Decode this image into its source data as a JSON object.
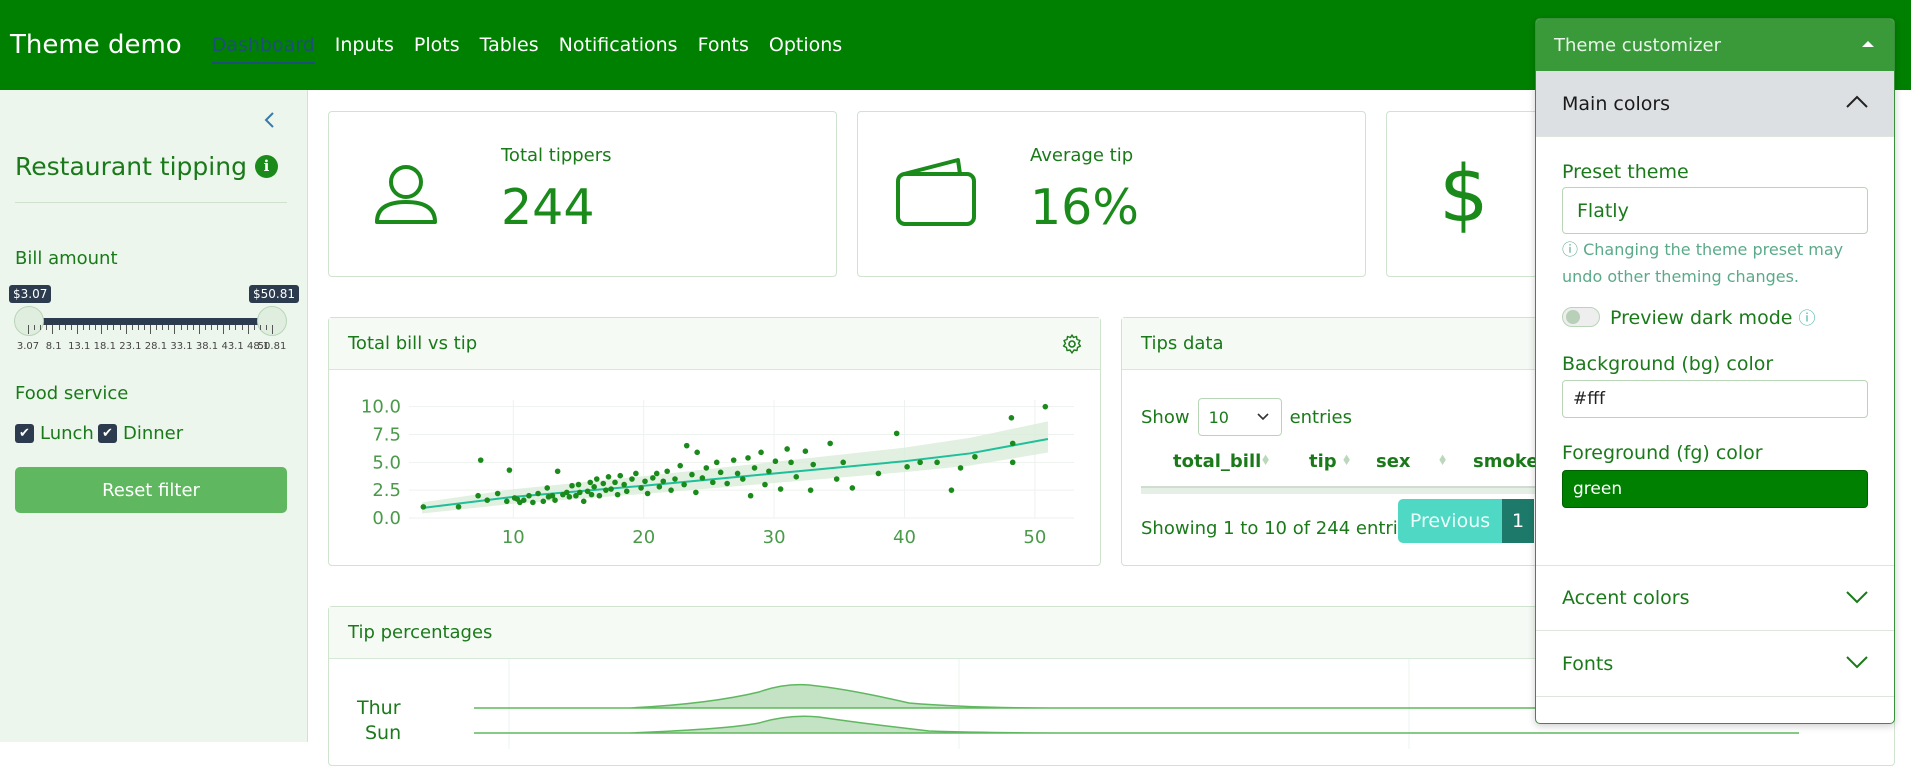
{
  "navbar": {
    "brand": "Theme demo",
    "links": [
      "Dashboard",
      "Inputs",
      "Plots",
      "Tables",
      "Notifications",
      "Fonts",
      "Options"
    ],
    "active": "Dashboard"
  },
  "sidebar": {
    "title": "Restaurant tipping",
    "info_icon": "info-icon",
    "bill_label": "Bill amount",
    "bill_min": "$3.07",
    "bill_max": "$50.81",
    "tick_labels": [
      "3.07",
      "8.1",
      "13.1",
      "18.1",
      "23.1",
      "28.1",
      "33.1",
      "38.1",
      "43.1",
      "48.1",
      "50.81"
    ],
    "food_label": "Food service",
    "lunch": "Lunch",
    "dinner": "Dinner",
    "lunch_checked": true,
    "dinner_checked": true,
    "reset": "Reset filter"
  },
  "value_boxes": [
    {
      "label": "Total tippers",
      "value": "244",
      "icon": "person-icon"
    },
    {
      "label": "Average tip",
      "value": "16%",
      "icon": "wallet-icon"
    },
    {
      "label": "",
      "value": "",
      "icon": "dollar-icon"
    }
  ],
  "scatter_card": {
    "title": "Total bill vs tip",
    "gear_icon": "gear-icon"
  },
  "tips_card": {
    "title": "Tips data",
    "show": "Show",
    "page_size": "10",
    "entries": "entries",
    "columns": [
      "total_bill",
      "tip",
      "sex",
      "smoke"
    ],
    "info": "Showing 1 to 10 of 244 entrie",
    "prev": "Previous",
    "page": "1"
  },
  "ridge_card": {
    "title": "Tip percentages",
    "days": [
      "Thur",
      "Sun"
    ]
  },
  "customizer": {
    "title": "Theme customizer",
    "main_colors": "Main colors",
    "preset_label": "Preset theme",
    "preset_value": "Flatly",
    "help": "Changing the theme preset may undo other theming changes.",
    "dark_mode": "Preview dark mode",
    "bg_label": "Background (bg) color",
    "bg_value": "#fff",
    "fg_label": "Foreground (fg) color",
    "fg_value": "green",
    "accent_colors": "Accent colors",
    "fonts": "Fonts"
  },
  "colors": {
    "primary": "#008000",
    "success": "#1a8a1a",
    "info": "#4fd8c4"
  },
  "chart_data": {
    "type": "scatter",
    "title": "",
    "xlabel": "",
    "ylabel": "",
    "xlim": [
      2,
      53
    ],
    "ylim": [
      0,
      10.6
    ],
    "x_ticks": [
      10,
      20,
      30,
      40,
      50
    ],
    "y_ticks": [
      "0.0",
      "2.5",
      "5.0",
      "7.5",
      "10.0"
    ],
    "grid": true,
    "points": [
      [
        3.1,
        1.0
      ],
      [
        5.8,
        1.0
      ],
      [
        7.3,
        2.0
      ],
      [
        7.5,
        5.2
      ],
      [
        8.0,
        1.6
      ],
      [
        8.8,
        2.2
      ],
      [
        9.5,
        1.5
      ],
      [
        9.7,
        4.3
      ],
      [
        10.1,
        1.8
      ],
      [
        10.3,
        1.7
      ],
      [
        10.5,
        1.4
      ],
      [
        10.8,
        1.6
      ],
      [
        11.2,
        2.0
      ],
      [
        11.5,
        1.4
      ],
      [
        11.9,
        2.2
      ],
      [
        12.3,
        1.5
      ],
      [
        12.6,
        2.7
      ],
      [
        12.7,
        1.9
      ],
      [
        13.0,
        2.0
      ],
      [
        13.2,
        1.6
      ],
      [
        13.4,
        4.2
      ],
      [
        13.8,
        2.1
      ],
      [
        14.1,
        2.3
      ],
      [
        14.3,
        1.9
      ],
      [
        14.5,
        2.9
      ],
      [
        14.8,
        2.0
      ],
      [
        15.0,
        3.0
      ],
      [
        15.1,
        2.3
      ],
      [
        15.4,
        1.5
      ],
      [
        15.7,
        2.4
      ],
      [
        15.9,
        3.2
      ],
      [
        16.0,
        2.1
      ],
      [
        16.2,
        2.8
      ],
      [
        16.4,
        3.5
      ],
      [
        16.6,
        2.0
      ],
      [
        16.9,
        3.1
      ],
      [
        17.1,
        2.5
      ],
      [
        17.3,
        3.7
      ],
      [
        17.5,
        2.6
      ],
      [
        17.8,
        3.2
      ],
      [
        18.0,
        2.1
      ],
      [
        18.2,
        3.8
      ],
      [
        18.5,
        3.0
      ],
      [
        18.7,
        2.4
      ],
      [
        19.1,
        3.5
      ],
      [
        19.4,
        4.0
      ],
      [
        19.8,
        2.7
      ],
      [
        20.1,
        3.3
      ],
      [
        20.3,
        2.2
      ],
      [
        20.7,
        3.6
      ],
      [
        21.0,
        4.0
      ],
      [
        21.2,
        2.8
      ],
      [
        21.5,
        3.3
      ],
      [
        21.8,
        4.2
      ],
      [
        22.1,
        2.5
      ],
      [
        22.4,
        3.5
      ],
      [
        22.8,
        4.7
      ],
      [
        23.1,
        3.0
      ],
      [
        23.3,
        6.5
      ],
      [
        23.7,
        3.9
      ],
      [
        24.0,
        2.3
      ],
      [
        24.1,
        5.9
      ],
      [
        24.5,
        3.6
      ],
      [
        24.8,
        4.5
      ],
      [
        25.3,
        3.2
      ],
      [
        25.6,
        5.0
      ],
      [
        25.9,
        4.1
      ],
      [
        26.4,
        3.1
      ],
      [
        26.9,
        5.2
      ],
      [
        27.2,
        4.0
      ],
      [
        27.6,
        3.5
      ],
      [
        28.0,
        5.4
      ],
      [
        28.2,
        2.0
      ],
      [
        28.5,
        4.5
      ],
      [
        29.0,
        5.9
      ],
      [
        29.3,
        3.0
      ],
      [
        29.6,
        4.2
      ],
      [
        30.1,
        5.1
      ],
      [
        30.5,
        2.6
      ],
      [
        31.0,
        6.2
      ],
      [
        31.3,
        5.0
      ],
      [
        31.7,
        3.7
      ],
      [
        32.4,
        6.0
      ],
      [
        32.8,
        2.5
      ],
      [
        33.0,
        4.8
      ],
      [
        34.3,
        6.7
      ],
      [
        34.8,
        3.5
      ],
      [
        35.3,
        5.0
      ],
      [
        36.0,
        2.7
      ],
      [
        38.0,
        4.0
      ],
      [
        39.4,
        7.6
      ],
      [
        40.2,
        4.6
      ],
      [
        41.2,
        5.0
      ],
      [
        42.5,
        5.0
      ],
      [
        43.6,
        2.5
      ],
      [
        44.3,
        4.5
      ],
      [
        45.4,
        5.5
      ],
      [
        48.2,
        9.0
      ],
      [
        48.3,
        6.7
      ],
      [
        48.3,
        5.0
      ],
      [
        50.8,
        10.0
      ]
    ],
    "fit_line": [
      [
        3,
        0.9
      ],
      [
        10,
        1.9
      ],
      [
        20,
        2.9
      ],
      [
        30,
        4.0
      ],
      [
        40,
        5.1
      ],
      [
        45,
        5.8
      ],
      [
        51,
        7.1
      ]
    ]
  }
}
